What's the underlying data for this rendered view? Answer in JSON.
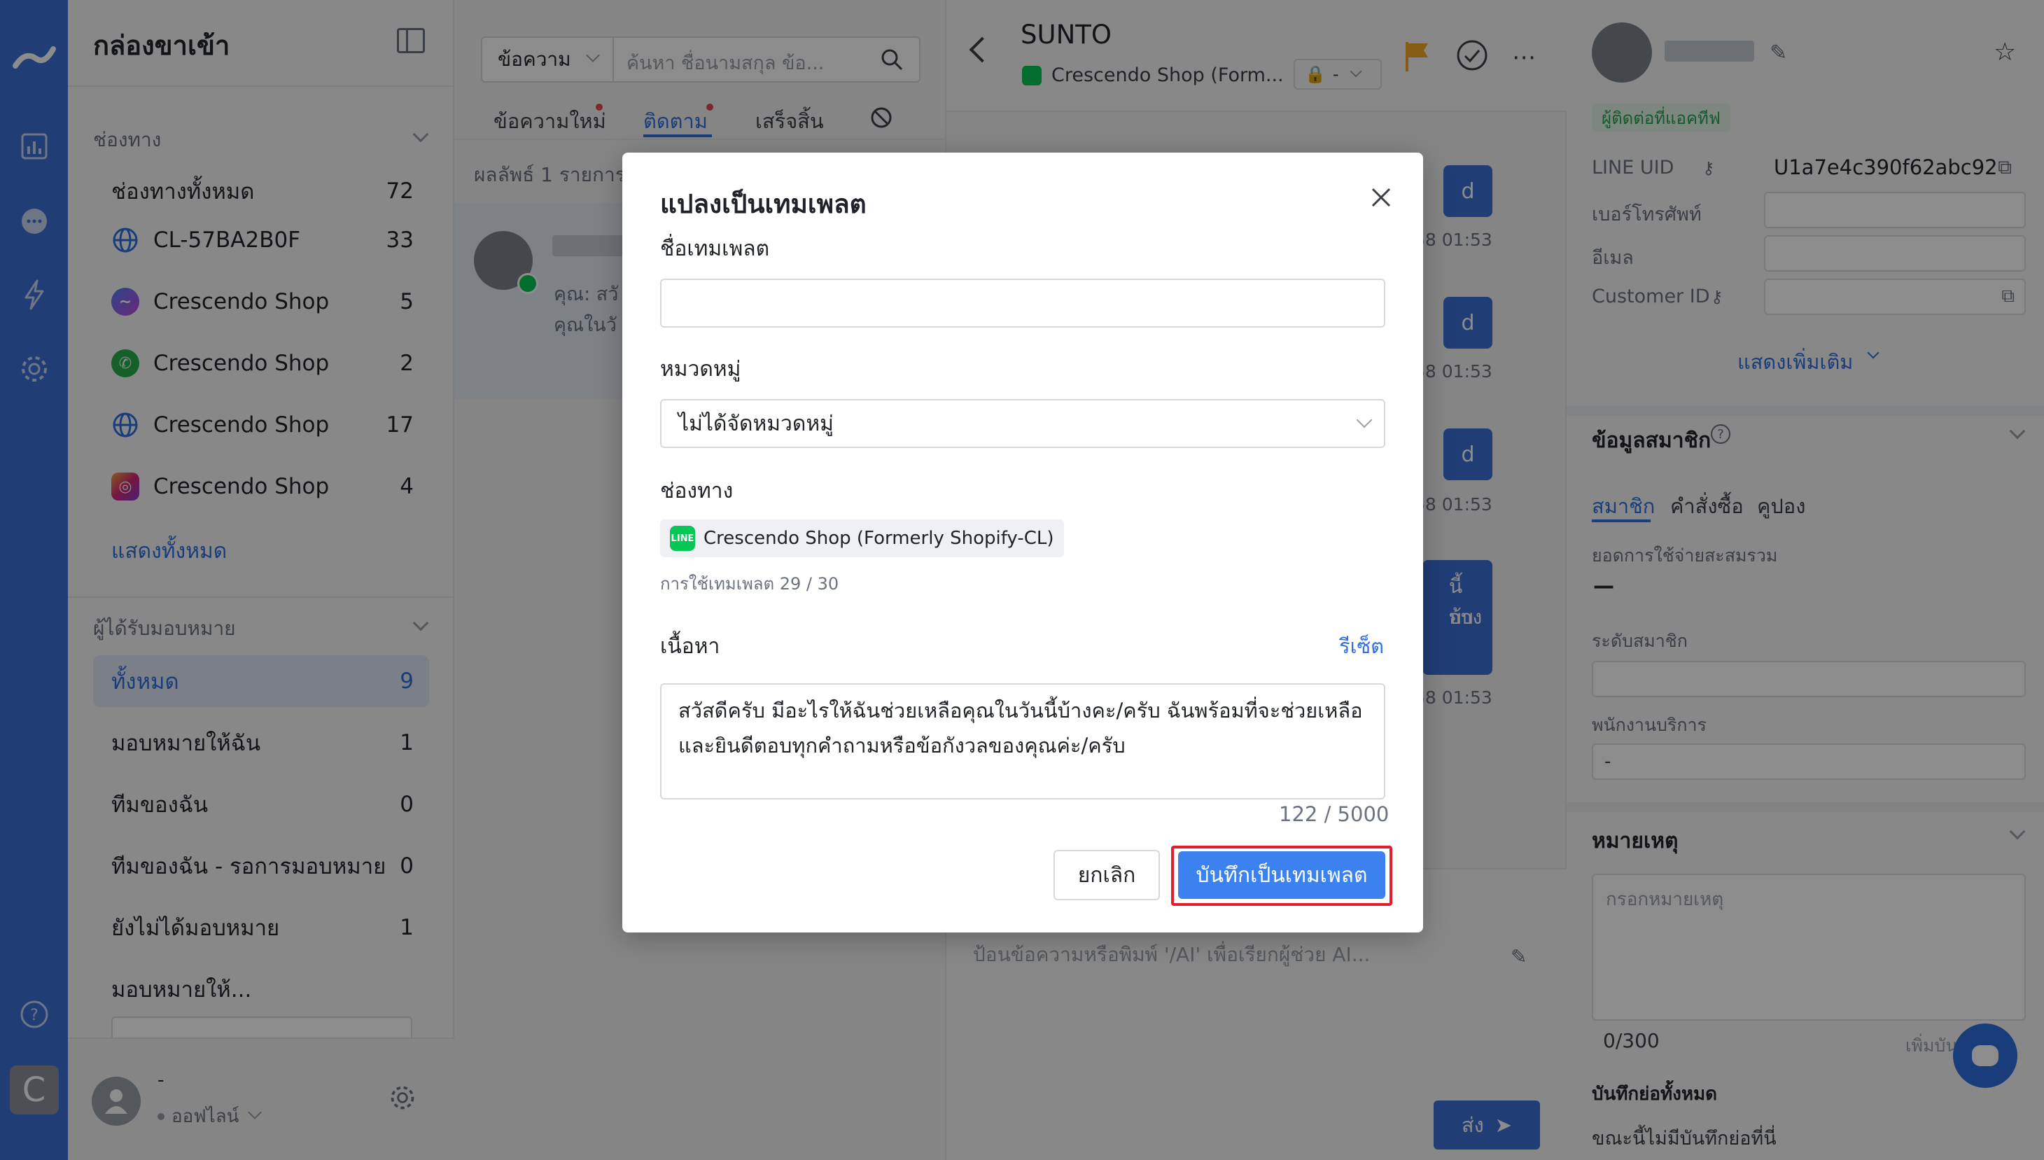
{
  "colors": {
    "brand": "#3b6fd8",
    "accent": "#2f6fe0",
    "line_green": "#06c755",
    "highlight": "#e11d2e",
    "flag": "#f5a623"
  },
  "rail": {
    "icons": [
      "logo-icon",
      "chart-icon",
      "chat-icon",
      "lightning-icon",
      "gear-icon",
      "help-icon",
      "workspace-icon"
    ],
    "workspace_letter": "C"
  },
  "sidebar": {
    "title": "กล่องขาเข้า",
    "channels_title": "ช่องทาง",
    "channels": [
      {
        "label": "ช่องทางทั้งหมด",
        "count": "72",
        "icon": ""
      },
      {
        "label": "CL-57BA2B0F",
        "count": "33",
        "icon": "globe-icon"
      },
      {
        "label": "Crescendo Shop",
        "count": "5",
        "icon": "messenger-icon"
      },
      {
        "label": "Crescendo Shop",
        "count": "2",
        "icon": "whatsapp-icon"
      },
      {
        "label": "Crescendo Shop",
        "count": "17",
        "icon": "globe-icon"
      },
      {
        "label": "Crescendo Shop",
        "count": "4",
        "icon": "instagram-icon"
      }
    ],
    "show_all": "แสดงทั้งหมด",
    "assignee_title": "ผู้ได้รับมอบหมาย",
    "assignees": [
      {
        "label": "ทั้งหมด",
        "count": "9"
      },
      {
        "label": "มอบหมายให้ฉัน",
        "count": "1"
      },
      {
        "label": "ทีมของฉัน",
        "count": "0"
      },
      {
        "label": "ทีมของฉัน - รอการมอบหมาย",
        "count": "0"
      },
      {
        "label": "ยังไม่ได้มอบหมาย",
        "count": "1"
      }
    ],
    "assign_to": "มอบหมายให้...",
    "user_name": "-",
    "user_status": "ออฟไลน์"
  },
  "convlist": {
    "filter_select": "ข้อความ",
    "search_placeholder": "ค้นหา ชื่อนามสกุล ข้อ...",
    "tabs": [
      "ข้อความใหม่",
      "ติดตาม",
      "เสร็จสิ้น"
    ],
    "result_text": "ผลลัพธ์ 1 รายการ",
    "item_preview_1": "คุณ: สวั",
    "item_preview_2": "คุณในวั"
  },
  "chat": {
    "contact_name": "SUNTO",
    "channel": "Crescendo Shop (Form...",
    "lock_value": "-",
    "bubble_letter": "d",
    "times": [
      "58 01:53",
      "58 01:53",
      "58 01:53",
      "58 01:53"
    ],
    "reply_fragment_1": "นี้บ้าง",
    "reply_fragment_2": "อบ",
    "composer_placeholder": "ป้อนข้อความหรือพิมพ์ '/AI' เพื่อเรียกผู้ช่วย AI...",
    "send_label": "ส่ง"
  },
  "profile": {
    "status_badge": "ผู้ติดต่อที่แอคทีฟ",
    "line_uid_label": "LINE UID",
    "line_uid_value": "U1a7e4c390f62abc92",
    "phone_label": "เบอร์โทรศัพท์",
    "email_label": "อีเมล",
    "customer_id_label": "Customer ID",
    "show_more": "แสดงเพิ่มเติม",
    "member_section": "ข้อมูลสมาชิก",
    "member_tabs": [
      "สมาชิก",
      "คำสั่งซื้อ",
      "คูปอง"
    ],
    "total_spent_label": "ยอดการใช้จ่ายสะสมรวม",
    "total_spent_value": "—",
    "member_level_label": "ระดับสมาชิก",
    "service_staff_label": "พนักงานบริการ",
    "service_staff_value": "-",
    "notes_section": "หมายเหตุ",
    "notes_placeholder": "กรอกหมายเหตุ",
    "notes_count": "0/300",
    "notes_add": "เพิ่มบัน",
    "all_notes_label": "บันทึกย่อทั้งหมด",
    "no_notes_text": "ขณะนี้ไม่มีบันทึกย่อที่นี่"
  },
  "modal": {
    "title": "แปลงเป็นเทมเพลต",
    "name_label": "ชื่อเทมเพลต",
    "name_value": "",
    "category_label": "หมวดหมู่",
    "category_value": "ไม่ได้จัดหมวดหมู่",
    "channel_label": "ช่องทาง",
    "channel_chip": "Crescendo Shop (Formerly Shopify-CL)",
    "usage_text": "การใช้เทมเพลต 29 / 30",
    "content_label": "เนื้อหา",
    "reset_label": "รีเซ็ต",
    "content_value": "สวัสดีครับ มีอะไรให้ฉันช่วยเหลือคุณในวันนี้บ้างคะ/ครับ ฉันพร้อมที่จะช่วยเหลือและยินดีตอบทุกคำถามหรือข้อกังวลของคุณค่ะ/ครับ",
    "char_count": "122 / 5000",
    "cancel_label": "ยกเลิก",
    "save_label": "บันทึกเป็นเทมเพลต"
  }
}
